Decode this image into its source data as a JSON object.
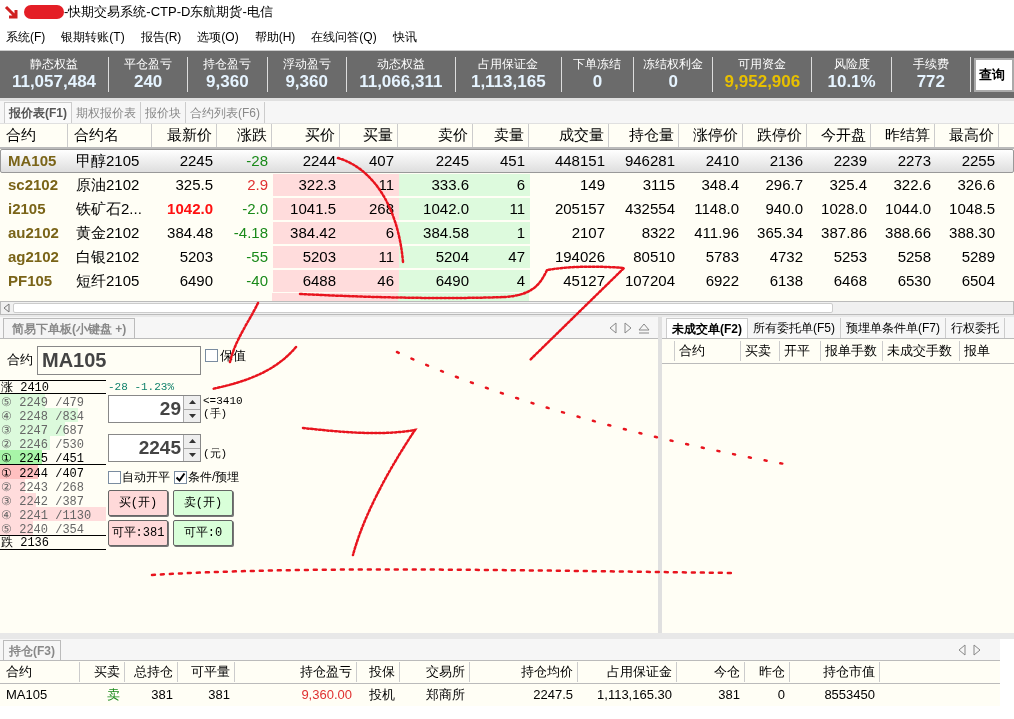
{
  "window": {
    "title": "-快期交易系统-CTP-D东航期货-电信"
  },
  "menu": [
    "系统(F)",
    "银期转账(T)",
    "报告(R)",
    "选项(O)",
    "帮助(H)",
    "在线问答(Q)",
    "快讯"
  ],
  "account_stats": [
    {
      "label": "静态权益",
      "value": "11,057,484",
      "highlight": false
    },
    {
      "label": "平仓盈亏",
      "value": "240",
      "highlight": false
    },
    {
      "label": "持仓盈亏",
      "value": "9,360",
      "highlight": false
    },
    {
      "label": "浮动盈亏",
      "value": "9,360",
      "highlight": false
    },
    {
      "label": "动态权益",
      "value": "11,066,311",
      "highlight": false
    },
    {
      "label": "占用保证金",
      "value": "1,113,165",
      "highlight": false
    },
    {
      "label": "下单冻结",
      "value": "0",
      "highlight": false
    },
    {
      "label": "冻结权利金",
      "value": "0",
      "highlight": false
    },
    {
      "label": "可用资金",
      "value": "9,952,906",
      "highlight": true
    },
    {
      "label": "风险度",
      "value": "10.1%",
      "highlight": false
    },
    {
      "label": "手续费",
      "value": "772",
      "highlight": false
    }
  ],
  "query_button": "查询",
  "quote_tabs": [
    {
      "label": "报价表(F1)",
      "selected": true
    },
    {
      "label": "期权报价表",
      "selected": false
    },
    {
      "label": "报价块",
      "selected": false
    },
    {
      "label": "合约列表(F6)",
      "selected": false
    }
  ],
  "quote_table": {
    "columns": [
      "合约",
      "合约名",
      "最新价",
      "涨跌",
      "买价",
      "买量",
      "卖价",
      "卖量",
      "成交量",
      "持仓量",
      "涨停价",
      "跌停价",
      "今开盘",
      "昨结算",
      "最高价"
    ],
    "rows": [
      {
        "selected": true,
        "rising": false,
        "latest_alert": false,
        "cells": [
          "MA105",
          "甲醇2105",
          "2245",
          "-28",
          "2244",
          "407",
          "2245",
          "451",
          "448151",
          "946281",
          "2410",
          "2136",
          "2239",
          "2273",
          "2255"
        ]
      },
      {
        "selected": false,
        "rising": true,
        "latest_alert": false,
        "cells": [
          "sc2102",
          "原油2102",
          "325.5",
          "2.9",
          "322.3",
          "11",
          "333.6",
          "6",
          "149",
          "3115",
          "348.4",
          "296.7",
          "325.4",
          "322.6",
          "326.6"
        ]
      },
      {
        "selected": false,
        "rising": false,
        "latest_alert": true,
        "cells": [
          "i2105",
          "铁矿石2...",
          "1042.0",
          "-2.0",
          "1041.5",
          "268",
          "1042.0",
          "11",
          "205157",
          "432554",
          "1148.0",
          "940.0",
          "1028.0",
          "1044.0",
          "1048.5"
        ]
      },
      {
        "selected": false,
        "rising": false,
        "latest_alert": false,
        "cells": [
          "au2102",
          "黄金2102",
          "384.48",
          "-4.18",
          "384.42",
          "6",
          "384.58",
          "1",
          "2107",
          "8322",
          "411.96",
          "365.34",
          "387.86",
          "388.66",
          "388.30"
        ]
      },
      {
        "selected": false,
        "rising": false,
        "latest_alert": false,
        "cells": [
          "ag2102",
          "白银2102",
          "5203",
          "-55",
          "5203",
          "11",
          "5204",
          "47",
          "194026",
          "80510",
          "5783",
          "4732",
          "5253",
          "5258",
          "5289"
        ]
      },
      {
        "selected": false,
        "rising": false,
        "latest_alert": false,
        "cells": [
          "PF105",
          "短纤2105",
          "6490",
          "-40",
          "6488",
          "46",
          "6490",
          "4",
          "45127",
          "107204",
          "6922",
          "6138",
          "6468",
          "6530",
          "6504"
        ]
      }
    ]
  },
  "order_panel": {
    "tab": "简易下单板(小键盘 +)",
    "contract_label": "合约",
    "contract": "MA105",
    "hedge": {
      "label": "保值",
      "checked": false
    },
    "limit_up": {
      "label": "涨",
      "price": "2410"
    },
    "asks": [
      {
        "rank": "⑤",
        "price": "2249",
        "volume": "/479",
        "level": 0.42
      },
      {
        "rank": "④",
        "price": "2248",
        "volume": "/834",
        "level": 0.74
      },
      {
        "rank": "③",
        "price": "2247",
        "volume": "/687",
        "level": 0.61
      },
      {
        "rank": "②",
        "price": "2246",
        "volume": "/530",
        "level": 0.47
      },
      {
        "rank": "①",
        "price": "2245",
        "volume": "/451",
        "level": 0.4
      }
    ],
    "bids": [
      {
        "rank": "①",
        "price": "2244",
        "volume": "/407",
        "level": 0.36
      },
      {
        "rank": "②",
        "price": "2243",
        "volume": "/268",
        "level": 0.24
      },
      {
        "rank": "③",
        "price": "2242",
        "volume": "/387",
        "level": 0.34
      },
      {
        "rank": "④",
        "price": "2241",
        "volume": "/1130",
        "level": 1
      },
      {
        "rank": "⑤",
        "price": "2240",
        "volume": "/354",
        "level": 0.31
      }
    ],
    "limit_down": {
      "label": "跌",
      "price": "2136"
    },
    "change": "-28 -1.23%",
    "quantity": {
      "value": "29",
      "limit": "<=3410",
      "unit": "(手)"
    },
    "price": {
      "value": "2245",
      "unit": "(元)"
    },
    "options": [
      {
        "label": "自动开平",
        "checked": false
      },
      {
        "label": "条件/预埋",
        "checked": true
      }
    ],
    "buttons": [
      {
        "label": "买(开)",
        "buy": true
      },
      {
        "label": "卖(开)",
        "buy": false
      },
      {
        "label": "可平:381",
        "buy": true
      },
      {
        "label": "可平:0",
        "buy": false
      }
    ]
  },
  "orders_panel": {
    "tabs": [
      {
        "label": "未成交单(F2)",
        "selected": true
      },
      {
        "label": "所有委托单(F5)",
        "selected": false
      },
      {
        "label": "预埋单条件单(F7)",
        "selected": false
      },
      {
        "label": "行权委托",
        "selected": false
      }
    ],
    "columns": [
      "合约",
      "买卖",
      "开平",
      "报单手数",
      "未成交手数",
      "报单"
    ]
  },
  "positions": {
    "tab": "持仓(F3)",
    "columns": [
      "合约",
      "买卖",
      "总持仓",
      "可平量",
      "持仓盈亏",
      "投保",
      "交易所",
      "持仓均价",
      "占用保证金",
      "今仓",
      "昨仓",
      "持仓市值"
    ],
    "rows": [
      {
        "buy": false,
        "pnl_positive": true,
        "cells": [
          "MA105",
          "卖",
          "381",
          "381",
          "9,360.00",
          "投机",
          "郑商所",
          "2247.5",
          "1,113,165.30",
          "381",
          "0",
          "8553450"
        ]
      }
    ]
  }
}
